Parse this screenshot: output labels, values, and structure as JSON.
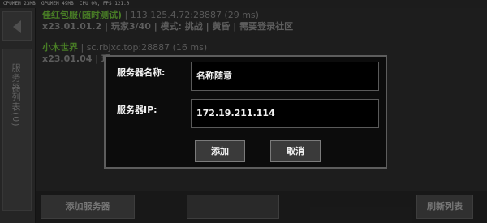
{
  "debug": {
    "text": "CPUMEM 23MB, GPUMEM 49MB, CPU 0%, FPS 121.0"
  },
  "sidebar": {
    "label": "服务器列表(0)",
    "back_icon": "back-arrow-icon"
  },
  "servers": [
    {
      "name": "佳红包服(随时测试)",
      "address": " | 113.125.4.72:28887 (29 ms)",
      "info": "x23.01.01.2 | 玩家3/40 | 模式: 挑战 | 黄昏 | 需要登录社区"
    },
    {
      "name": "小木世界",
      "address": " | sc.rbjxc.top:28887 (16 ms)",
      "info": "x23.01.04 | 玩"
    }
  ],
  "bottom": {
    "add_server": "添加服务器",
    "middle": "",
    "refresh": "刷新列表"
  },
  "dialog": {
    "name_label": "服务器名称:",
    "name_value": "名称随意",
    "ip_label": "服务器IP:",
    "ip_value": "172.19.211.114",
    "add_button": "添加",
    "cancel_button": "取消"
  }
}
